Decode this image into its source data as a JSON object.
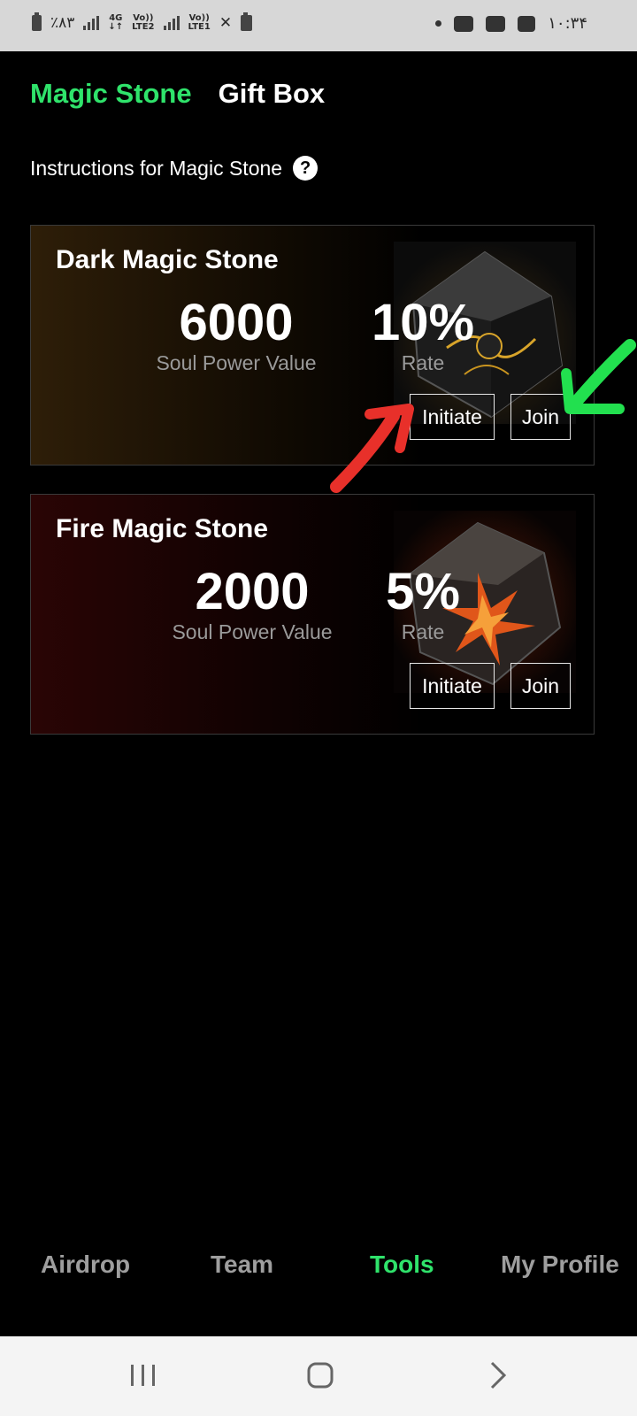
{
  "status_bar": {
    "battery_text": "٪۸۳",
    "net_4g": "4G",
    "lte2": "LTE2",
    "lte1": "LTE1",
    "volte": "Vo))",
    "time": "۱۰:۳۴"
  },
  "tabs": [
    {
      "label": "Magic Stone",
      "active": true
    },
    {
      "label": "Gift Box",
      "active": false
    }
  ],
  "instructions": {
    "label": "Instructions for Magic Stone",
    "icon": "?"
  },
  "stones": [
    {
      "title": "Dark Magic Stone",
      "soul_power_value": "6000",
      "soul_power_label": "Soul Power Value",
      "rate": "10%",
      "rate_label": "Rate",
      "initiate_label": "Initiate",
      "join_label": "Join"
    },
    {
      "title": "Fire Magic Stone",
      "soul_power_value": "2000",
      "soul_power_label": "Soul Power Value",
      "rate": "5%",
      "rate_label": "Rate",
      "initiate_label": "Initiate",
      "join_label": "Join"
    }
  ],
  "bottom_nav": [
    {
      "label": "Airdrop",
      "active": false
    },
    {
      "label": "Team",
      "active": false
    },
    {
      "label": "Tools",
      "active": true
    },
    {
      "label": "My Profile",
      "active": false
    }
  ],
  "colors": {
    "accent_green": "#2fe36b",
    "annotation_red": "#e8302a",
    "annotation_green": "#22e04f"
  }
}
